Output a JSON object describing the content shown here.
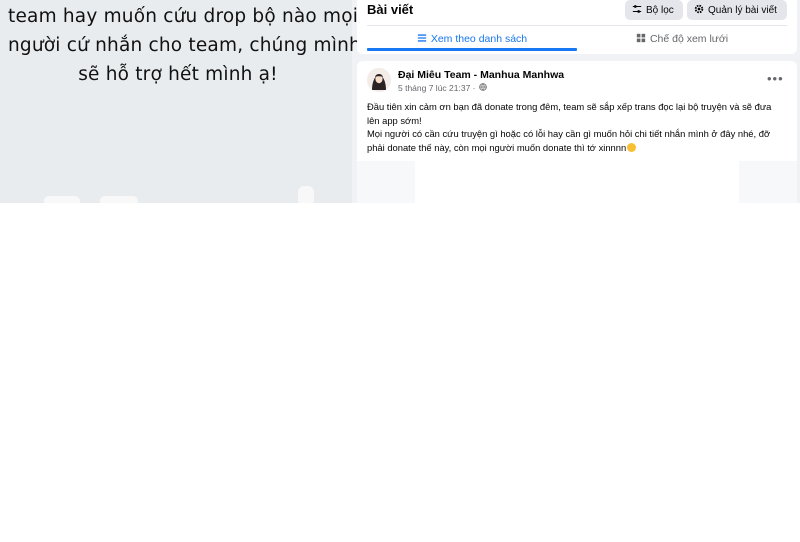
{
  "note": {
    "lines": [
      "team hay muốn cứu drop bộ nào mọi",
      "người cứ nhắn cho team, chúng mình",
      "sẽ hỗ trợ hết mình ạ!"
    ]
  },
  "posts": {
    "title": "Bài viết",
    "filter_label": "Bộ lọc",
    "manage_label": "Quản lý bài viết",
    "tab_list_label": "Xem theo danh sách",
    "tab_grid_label": "Chế độ xem lưới",
    "active_tab": "list"
  },
  "post": {
    "author": "Đại Miêu Team - Manhua Manhwa",
    "timestamp": "5 tháng 7 lúc 21:37 ·",
    "more_label": "•••",
    "paragraphs": [
      "Đầu tiên xin cảm ơn bạn đã donate trong đêm, team sẽ sắp xếp trans đọc lại bộ truyện và sẽ đưa",
      "lên app sớm!",
      "Mọi người có cần cứu truyện gì hoặc có lỗi hay cần gì muốn hỏi chi tiết nhắn mình ở đây nhé, đỡ",
      "phải donate thế này, còn mọi người muốn donate thì tớ xinnnn"
    ]
  },
  "colors": {
    "accent": "#1877f2",
    "secondary_text": "#65676b",
    "page_bg": "#f0f2f5"
  }
}
